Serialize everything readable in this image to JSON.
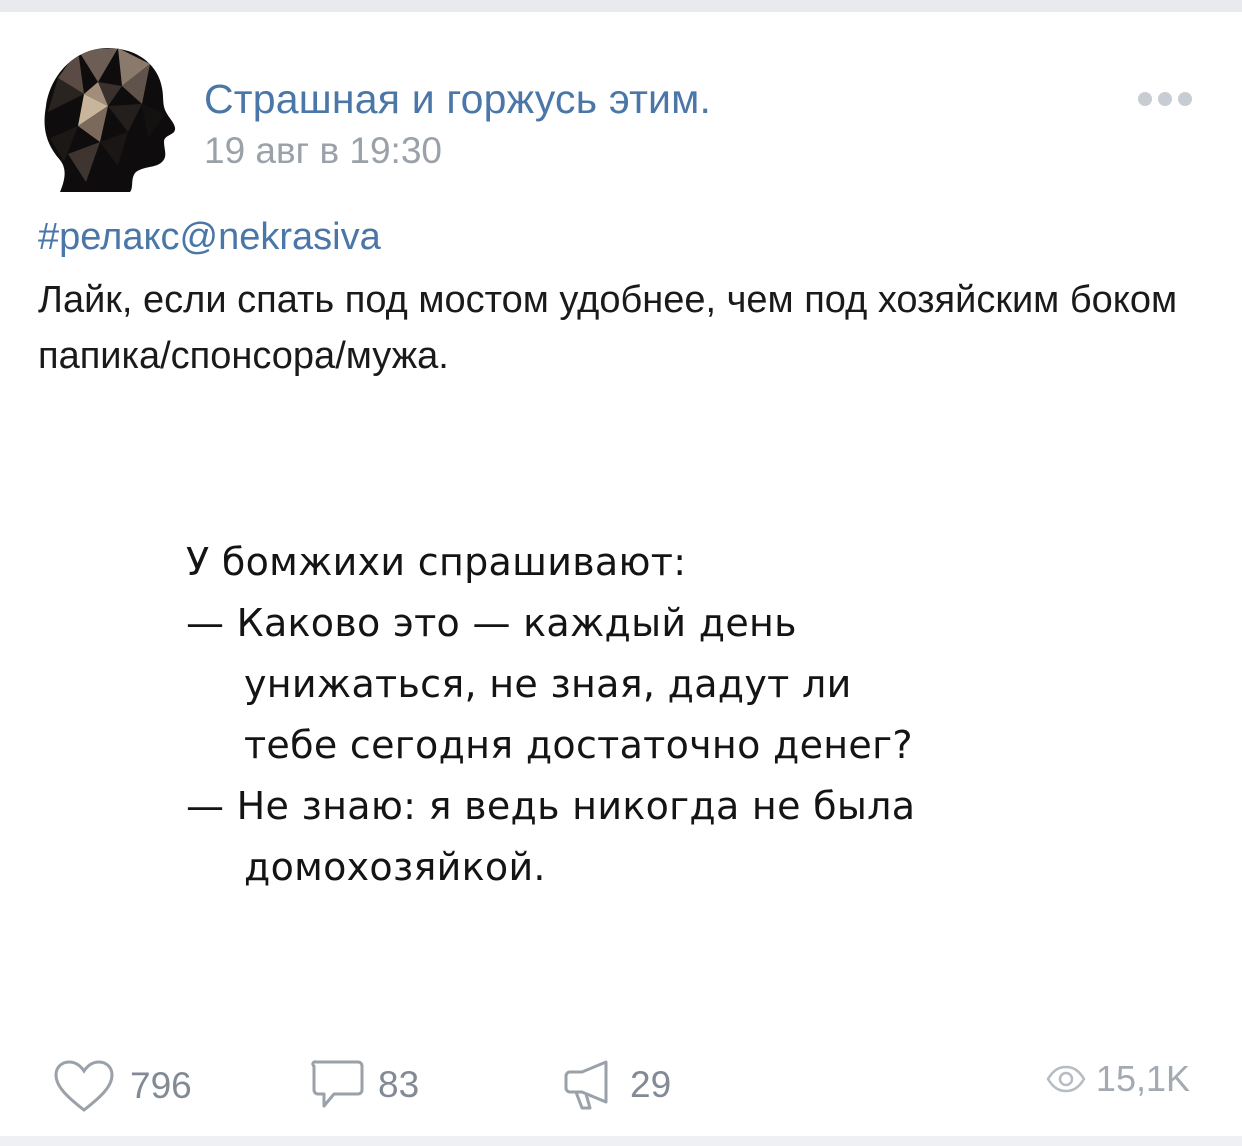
{
  "post": {
    "author": "Страшная и горжусь этим.",
    "date": "19 авг в 19:30",
    "hashtag": "#релакс@nekrasiva",
    "text": "Лайк, если спать под мостом удобнее, чем под хозяйским боком папика/спонсора/мужа."
  },
  "image": {
    "lines": [
      "У бомжихи спрашивают:",
      "— Каково это — каждый день",
      "унижаться, не зная, дадут ли",
      "тебе сегодня достаточно денег?",
      "— Не знаю: я ведь никогда не была",
      "домохозяйкой."
    ]
  },
  "footer": {
    "likes": "796",
    "comments": "83",
    "shares": "29",
    "views": "15,1K"
  },
  "icons": {
    "more": "more-dots-icon",
    "like": "heart-icon",
    "comment": "comment-icon",
    "share": "megaphone-icon",
    "views": "eye-icon"
  },
  "colors": {
    "link": "#4a76a8",
    "meta": "#9aa1a9",
    "text": "#1a1a1a",
    "icon": "#828a94"
  }
}
